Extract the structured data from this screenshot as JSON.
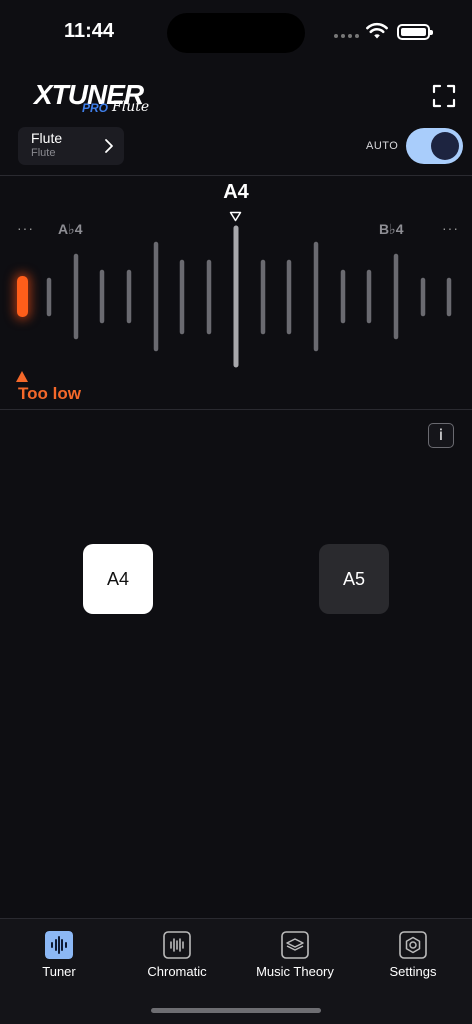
{
  "status_bar": {
    "time": "11:44"
  },
  "header": {
    "logo_main": "XTUNER",
    "logo_pro": "PRO",
    "logo_sub": "Flute",
    "instrument": {
      "name": "Flute",
      "sub": "Flute"
    },
    "auto_label": "AUTO",
    "auto_enabled": true,
    "colors": {
      "toggle_track": "#a9cdfb",
      "logo_pro": "#3f7ee8"
    }
  },
  "tuner": {
    "note": "A4",
    "left_note": "A♭4",
    "right_note": "B♭4",
    "left_more": "···",
    "right_more": "···",
    "status": "Too low",
    "colors": {
      "indicator": "#ff5e1a",
      "warning": "#f4682a"
    }
  },
  "info_label": "i",
  "note_buttons": [
    {
      "label": "A4",
      "selected": true
    },
    {
      "label": "A5",
      "selected": false
    }
  ],
  "tabs": [
    {
      "label": "Tuner",
      "icon": "tuner-icon",
      "active": true
    },
    {
      "label": "Chromatic",
      "icon": "chromatic-icon",
      "active": false
    },
    {
      "label": "Music Theory",
      "icon": "music-theory-icon",
      "active": false
    },
    {
      "label": "Settings",
      "icon": "settings-icon",
      "active": false
    }
  ]
}
